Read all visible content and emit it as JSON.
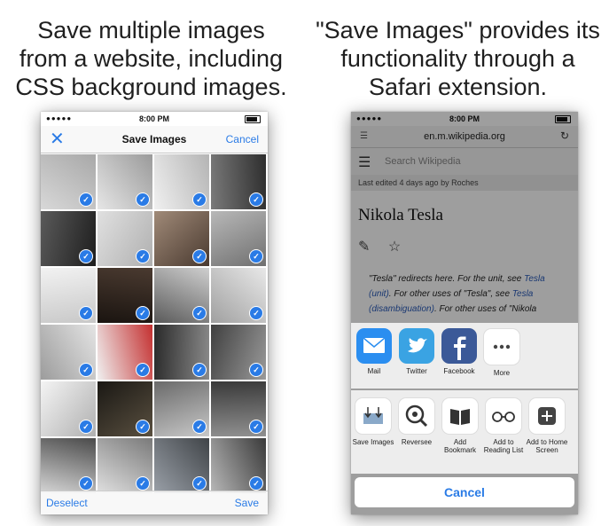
{
  "left": {
    "caption": [
      "Save multiple images",
      "from a website, including",
      "CSS background images."
    ],
    "status": {
      "time": "8:00 PM"
    },
    "navbar": {
      "title": "Save Images",
      "cancel_label": "Cancel"
    },
    "toolbar": {
      "deselect_label": "Deselect",
      "save_label": "Save"
    },
    "grid_count": 24
  },
  "right": {
    "caption": [
      "\"Save Images\" provides its",
      "functionality through a",
      "Safari extension."
    ],
    "status": {
      "time": "8:00 PM"
    },
    "url": "en.m.wikipedia.org",
    "search_placeholder": "Search Wikipedia",
    "last_edited": "Last edited 4 days ago by Roches",
    "page_title": "Nikola Tesla",
    "body": {
      "t1": "\"Tesla\" redirects here. For the unit, see ",
      "l1": "Tesla (unit)",
      "t2": ". For other uses of \"Tesla\", see ",
      "l2": "Tesla (disambiguation)",
      "t3": ". For other uses of \"Nikola"
    },
    "share_apps": [
      {
        "label": "Mail",
        "icon": "mail-icon",
        "color": "#2b8ef0"
      },
      {
        "label": "Twitter",
        "icon": "twitter-icon",
        "color": "#3aa3e3"
      },
      {
        "label": "Facebook",
        "icon": "facebook-icon",
        "color": "#3b5998"
      },
      {
        "label": "More",
        "icon": "more-icon",
        "color": "#ffffff"
      }
    ],
    "actions": [
      {
        "label": "Save Images",
        "icon": "save-images-icon",
        "glyph": "⤓"
      },
      {
        "label": "Reversee",
        "icon": "reversee-icon",
        "glyph": "⊙"
      },
      {
        "label": "Add Bookmark",
        "icon": "bookmark-icon",
        "glyph": "▯"
      },
      {
        "label": "Add to Reading List",
        "icon": "reading-list-icon",
        "glyph": "∞"
      },
      {
        "label": "Add to Home Screen",
        "icon": "home-screen-icon",
        "glyph": "+"
      }
    ],
    "cancel_label": "Cancel"
  },
  "colors": {
    "accent": "#2a7be6"
  }
}
